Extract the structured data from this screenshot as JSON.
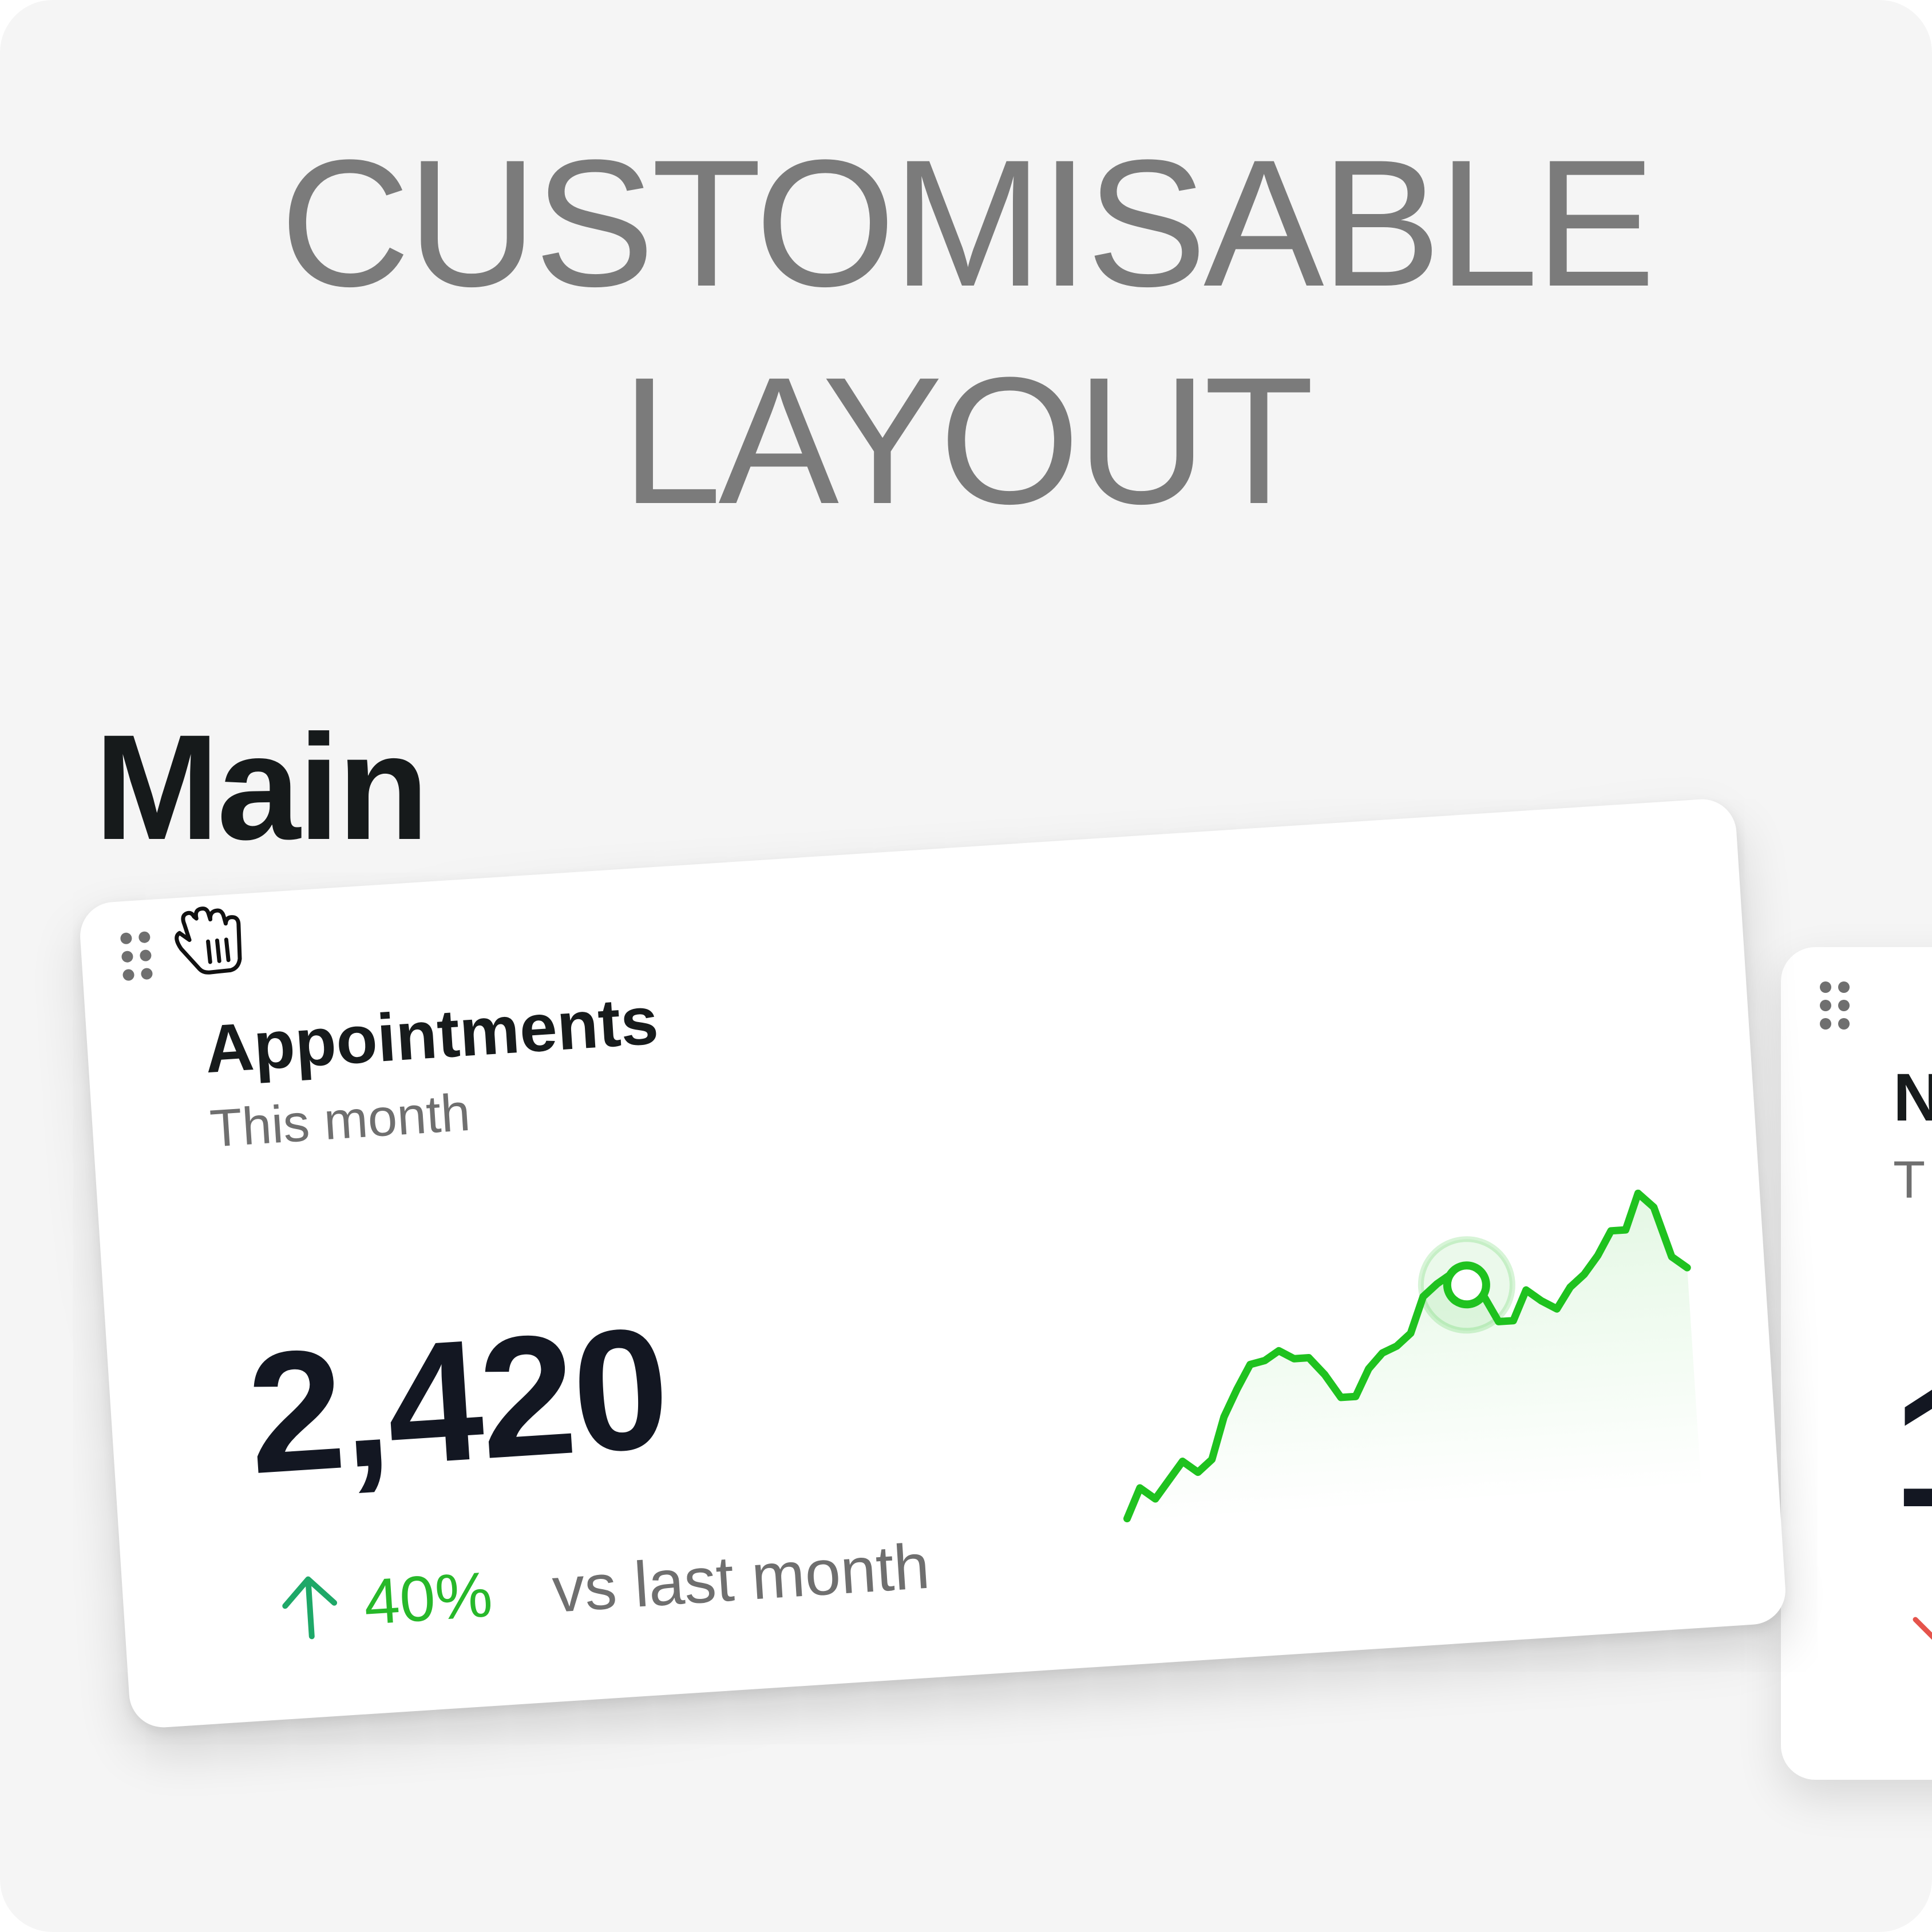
{
  "headline": {
    "line1": "CUSTOMISABLE",
    "line2": "LAYOUT"
  },
  "section": {
    "title": "Main"
  },
  "cards": {
    "appointments": {
      "title": "Appointments",
      "subtitle": "This month",
      "value": "2,420",
      "trend_percent": "40%",
      "trend_label": "vs last month",
      "trend_direction": "up",
      "colors": {
        "line": "#1fc21f",
        "trend_arrow": "#1ea868",
        "trend_text": "#27b82a"
      }
    },
    "next_card": {
      "title": "N",
      "subtitle": "T",
      "value": "1",
      "trend_direction": "down",
      "colors": {
        "trend_arrow": "#e5534b"
      }
    }
  },
  "chart_data": {
    "type": "area",
    "title": "",
    "xlabel": "",
    "ylabel": "",
    "x": [
      1,
      2,
      3,
      4,
      5,
      6,
      7,
      8,
      9,
      10,
      11,
      12,
      13,
      14,
      15,
      16,
      17,
      18,
      19,
      20,
      21,
      22,
      23,
      24,
      25,
      26,
      27,
      28,
      29,
      30,
      31,
      32,
      33,
      34,
      35,
      36,
      37,
      38,
      39,
      40
    ],
    "series": [
      {
        "values": [
          2,
          12,
          8,
          14,
          20,
          16,
          20,
          34,
          43,
          51,
          52,
          55,
          52,
          52,
          46,
          38,
          38,
          47,
          52,
          54,
          58,
          70,
          74,
          77,
          73,
          70,
          60,
          60,
          70,
          66,
          63,
          70,
          74,
          80,
          88,
          88,
          100,
          95,
          78,
          74
        ]
      }
    ],
    "highlight_index": 24,
    "ylim": [
      0,
      100
    ],
    "grid": false,
    "legend": "none"
  },
  "icons": {
    "drag_handle": "drag-handle-icon",
    "grab_cursor": "grab-cursor-icon",
    "trend_up": "arrow-up-icon",
    "trend_down": "arrow-down-icon"
  }
}
